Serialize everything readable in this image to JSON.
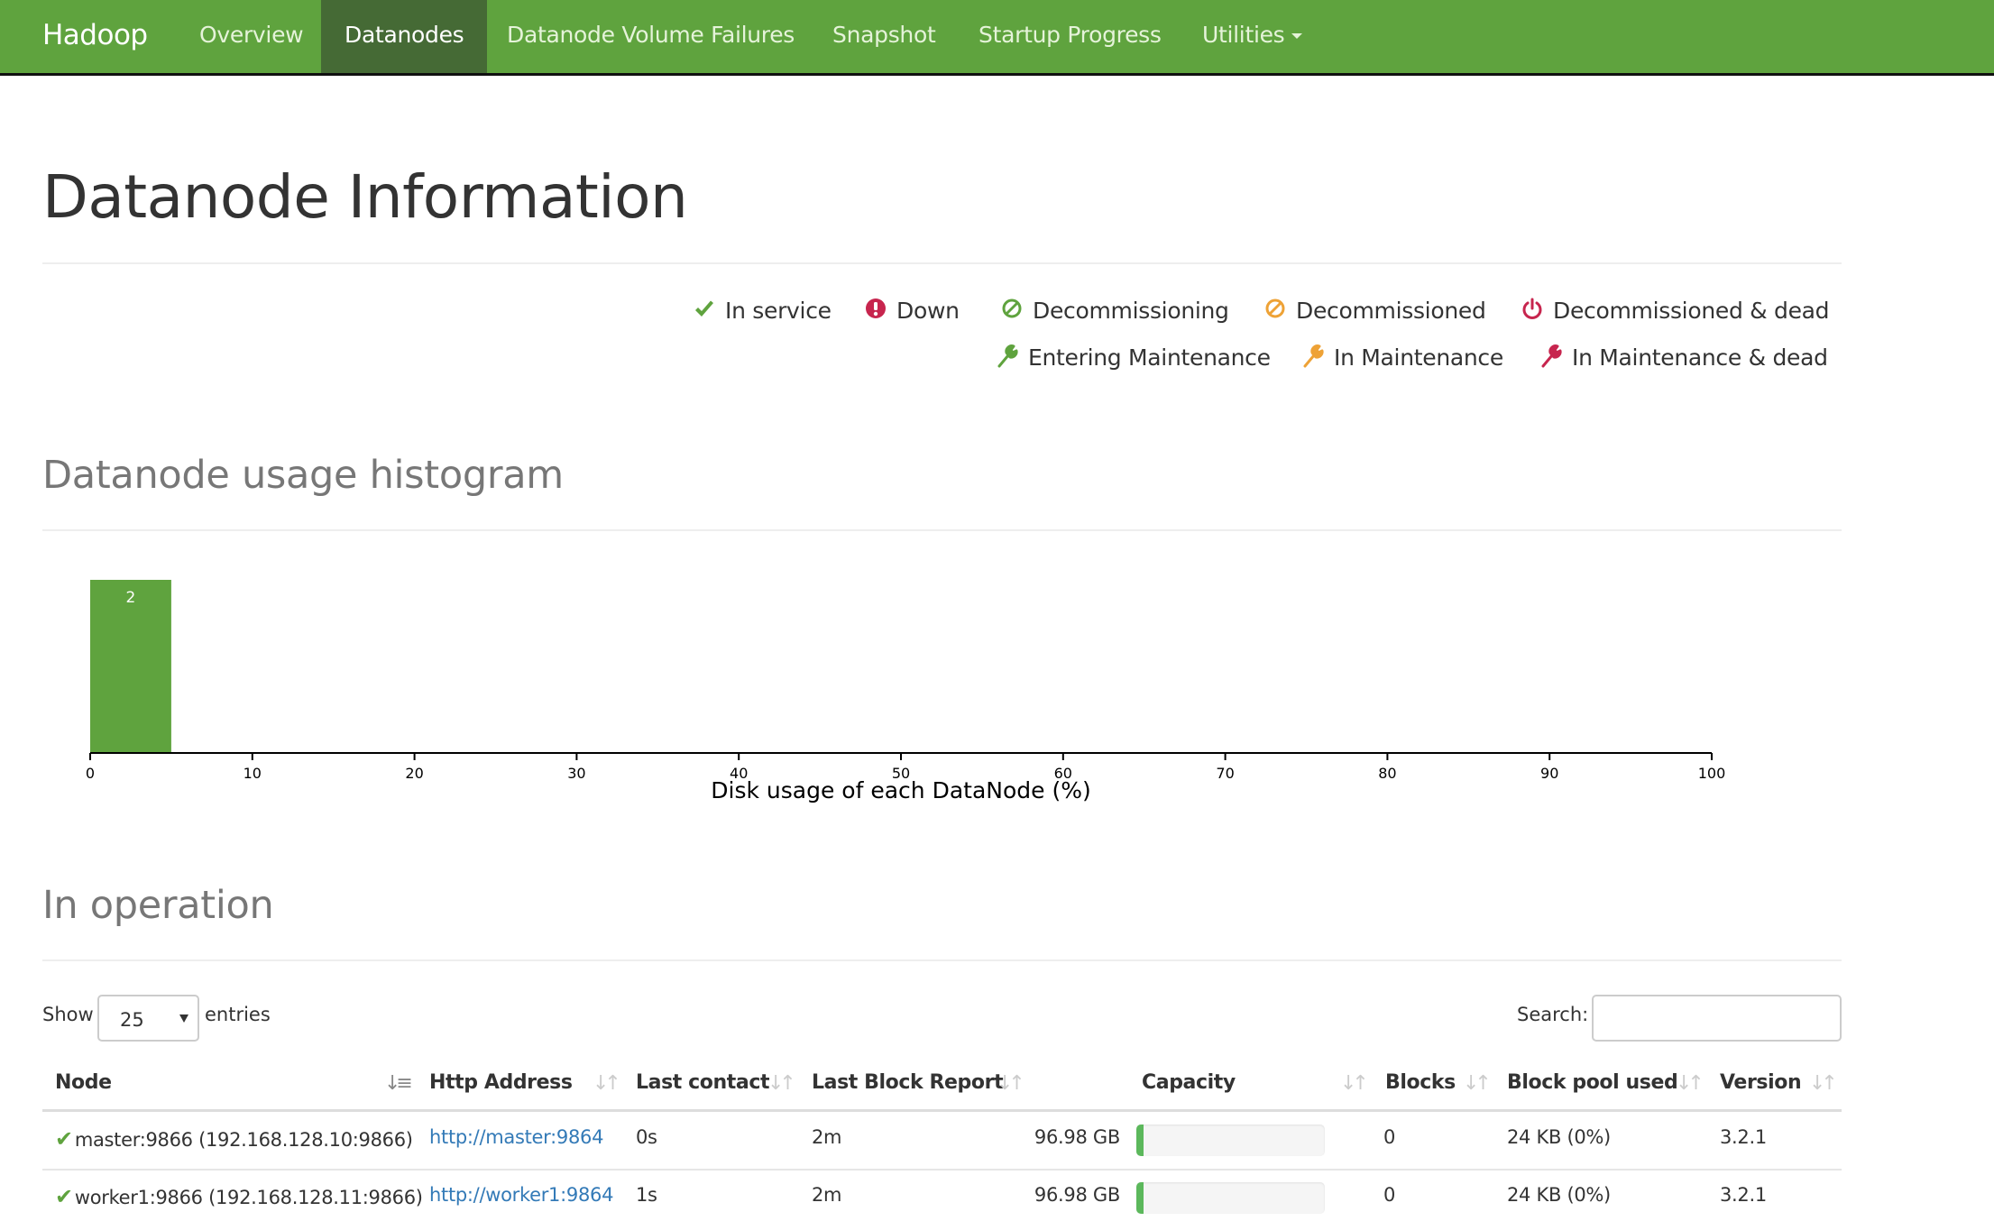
{
  "navbar": {
    "brand": "Hadoop",
    "items": [
      {
        "label": "Overview",
        "active": false
      },
      {
        "label": "Datanodes",
        "active": true
      },
      {
        "label": "Datanode Volume Failures",
        "active": false
      },
      {
        "label": "Snapshot",
        "active": false
      },
      {
        "label": "Startup Progress",
        "active": false
      },
      {
        "label": "Utilities",
        "active": false,
        "dropdown": true
      }
    ]
  },
  "page": {
    "title": "Datanode Information"
  },
  "legend": [
    {
      "icon": "check-icon",
      "label": "In service",
      "color": "#5fa33e"
    },
    {
      "icon": "exclamation-circle-icon",
      "label": "Down",
      "color": "#c7254e"
    },
    {
      "icon": "ban-icon",
      "label": "Decommissioning",
      "color": "#5fa33e"
    },
    {
      "icon": "ban-icon",
      "label": "Decommissioned",
      "color": "#eea236"
    },
    {
      "icon": "power-off-icon",
      "label": "Decommissioned & dead",
      "color": "#c7254e"
    },
    {
      "icon": "wrench-icon",
      "label": "Entering Maintenance",
      "color": "#5fa33e"
    },
    {
      "icon": "wrench-icon",
      "label": "In Maintenance",
      "color": "#eea236"
    },
    {
      "icon": "wrench-icon",
      "label": "In Maintenance & dead",
      "color": "#c7254e"
    }
  ],
  "histogram": {
    "title": "Datanode usage histogram"
  },
  "chart_data": {
    "type": "bar",
    "title": "Datanode usage histogram",
    "xlabel": "Disk usage of each DataNode (%)",
    "ylabel": "",
    "xlim": [
      0,
      100
    ],
    "xticks": [
      0,
      10,
      20,
      30,
      40,
      50,
      60,
      70,
      80,
      90,
      100
    ],
    "bins": [
      {
        "x0": 0,
        "x1": 5,
        "count": 2
      }
    ],
    "ymax": 2,
    "bar_color": "#5fa33e",
    "grid": false,
    "legend": "none"
  },
  "operation": {
    "title": "In operation",
    "show_label": "Show",
    "entries_value": "25",
    "entries_label": "entries",
    "search_label": "Search:",
    "search_value": "",
    "columns": [
      {
        "label": "Node",
        "sort": "asc"
      },
      {
        "label": "Http Address",
        "sort": "none"
      },
      {
        "label": "Last contact",
        "sort": "none"
      },
      {
        "label": "Last Block Report",
        "sort": "none"
      },
      {
        "label": "Capacity",
        "sort": "none"
      },
      {
        "label": "Blocks",
        "sort": "none"
      },
      {
        "label": "Block pool used",
        "sort": "none"
      },
      {
        "label": "Version",
        "sort": "none"
      }
    ],
    "rows": [
      {
        "status": "in-service",
        "node": "master:9866 (192.168.128.10:9866)",
        "http": "http://master:9864",
        "last_contact": "0s",
        "last_block_report": "2m",
        "capacity": "96.98 GB",
        "capacity_used_pct": 0,
        "blocks": "0",
        "block_pool_used": "24 KB (0%)",
        "version": "3.2.1"
      },
      {
        "status": "in-service",
        "node": "worker1:9866 (192.168.128.11:9866)",
        "http": "http://worker1:9864",
        "last_contact": "1s",
        "last_block_report": "2m",
        "capacity": "96.98 GB",
        "capacity_used_pct": 0,
        "blocks": "0",
        "block_pool_used": "24 KB (0%)",
        "version": "3.2.1"
      }
    ]
  }
}
